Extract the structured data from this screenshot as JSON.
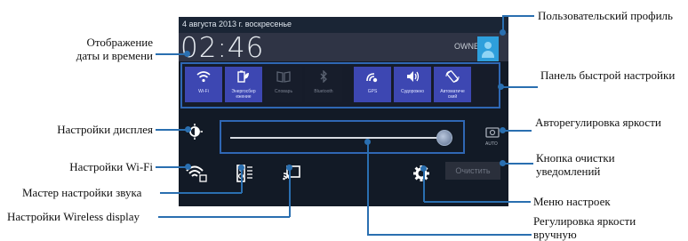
{
  "device": {
    "date": "4 августа 2013 г. воскресенье",
    "time": "02:46",
    "owner": "OWNER",
    "clear_button": "Очистить",
    "auto_label": "AUTO",
    "slider_level": 0.96,
    "tiles": [
      {
        "name": "wifi",
        "label": "Wi-Fi",
        "active": true,
        "icon": "wifi-icon"
      },
      {
        "name": "power-saving",
        "label": "Энергосбер\nежение",
        "active": true,
        "icon": "battery-leaf-icon"
      },
      {
        "name": "dictionary",
        "label": "Словарь",
        "active": false,
        "icon": "book-icon"
      },
      {
        "name": "bluetooth",
        "label": "Bluetooth",
        "active": false,
        "icon": "bluetooth-icon"
      },
      {
        "name": "gps",
        "label": "GPS",
        "active": true,
        "icon": "satellite-icon"
      },
      {
        "name": "sound",
        "label": "Судорожно",
        "active": true,
        "icon": "speaker-icon"
      },
      {
        "name": "auto-rotate",
        "label": "Автоматиче\nский",
        "active": true,
        "icon": "rotate-icon"
      }
    ]
  },
  "callouts": {
    "user_profile": "Пользовательский профиль",
    "date_time_1": "Отображение",
    "date_time_2": "даты и времени",
    "quick_settings": "Панель быстрой настройки",
    "display_settings": "Настройки дисплея",
    "auto_brightness": "Авторегулировка яркости",
    "wifi_settings": "Настройки Wi-Fi",
    "clear_notifications_1": "Кнопка очистки",
    "clear_notifications_2": "уведомлений",
    "sound_wizard": "Мастер настройки звука",
    "settings_menu": "Меню настроек",
    "wireless_display": "Настройки Wireless display",
    "manual_brightness_1": "Регулировка яркости",
    "manual_brightness_2": "вручную"
  },
  "colors": {
    "accent": "#2a6fb0",
    "tile_active": "#3d47b2",
    "panel_bg": "#121a26",
    "avatar": "#2e9fdc"
  }
}
